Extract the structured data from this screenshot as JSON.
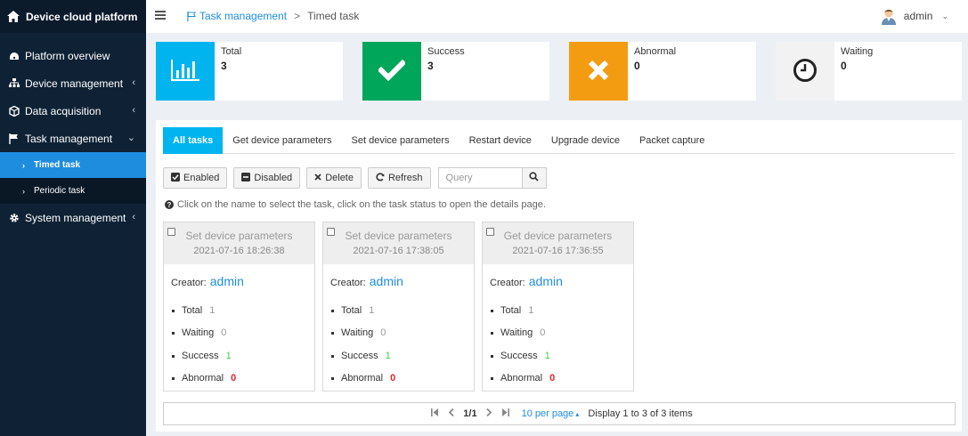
{
  "sidebar": {
    "brand": "Device cloud platform",
    "items": [
      {
        "label": "Platform overview"
      },
      {
        "label": "Device management"
      },
      {
        "label": "Data acquisition"
      },
      {
        "label": "Task management"
      },
      {
        "label": "System management"
      }
    ],
    "sub_items": [
      {
        "label": "Timed task"
      },
      {
        "label": "Periodic task"
      }
    ]
  },
  "header": {
    "breadcrumb_parent": "Task management",
    "breadcrumb_sep": ">",
    "breadcrumb_current": "Timed task",
    "user": "admin"
  },
  "stats": [
    {
      "label": "Total",
      "value": "3",
      "color": "#00b4ef"
    },
    {
      "label": "Success",
      "value": "3",
      "color": "#00a65a"
    },
    {
      "label": "Abnormal",
      "value": "0",
      "color": "#f39c12"
    },
    {
      "label": "Waiting",
      "value": "0",
      "color": "#f2f2f2"
    }
  ],
  "tabs": [
    {
      "label": "All tasks"
    },
    {
      "label": "Get device parameters"
    },
    {
      "label": "Set device parameters"
    },
    {
      "label": "Restart device"
    },
    {
      "label": "Upgrade device"
    },
    {
      "label": "Packet capture"
    }
  ],
  "toolbar": {
    "enabled": "Enabled",
    "disabled": "Disabled",
    "delete": "Delete",
    "refresh": "Refresh",
    "query_placeholder": "Query"
  },
  "hint": "Click on the name to select the task, click on the task status to open the details page.",
  "tasks": [
    {
      "name": "Set device parameters",
      "time": "2021-07-16 18:26:38",
      "creator_label": "Creator:",
      "creator": "admin",
      "total_label": "Total",
      "total": "1",
      "waiting_label": "Waiting",
      "waiting": "0",
      "success_label": "Success",
      "success": "1",
      "abnormal_label": "Abnormal",
      "abnormal": "0"
    },
    {
      "name": "Set device parameters",
      "time": "2021-07-16 17:38:05",
      "creator_label": "Creator:",
      "creator": "admin",
      "total_label": "Total",
      "total": "1",
      "waiting_label": "Waiting",
      "waiting": "0",
      "success_label": "Success",
      "success": "1",
      "abnormal_label": "Abnormal",
      "abnormal": "0"
    },
    {
      "name": "Get device parameters",
      "time": "2021-07-16 17:36:55",
      "creator_label": "Creator:",
      "creator": "admin",
      "total_label": "Total",
      "total": "1",
      "waiting_label": "Waiting",
      "waiting": "0",
      "success_label": "Success",
      "success": "1",
      "abnormal_label": "Abnormal",
      "abnormal": "0"
    }
  ],
  "pager": {
    "page": "1/1",
    "per_page": "10 per page",
    "info": "Display 1 to 3 of 3 items"
  },
  "colors": {
    "accent": "#1f8dde",
    "sidebar_bg": "#0f2235",
    "active_tab": "#00b4ef"
  }
}
